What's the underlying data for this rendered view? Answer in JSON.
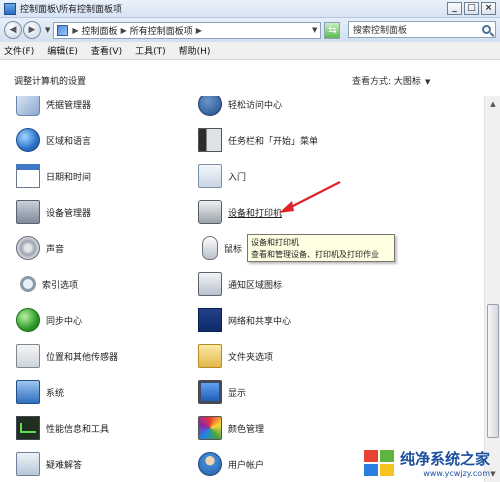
{
  "window": {
    "title": "控制面板\\所有控制面板项",
    "buttons": [
      "_",
      "□",
      "×"
    ]
  },
  "address": {
    "crumbs": [
      "控制面板",
      "所有控制面板项"
    ],
    "search_placeholder": "搜索控制面板"
  },
  "menu": [
    "文件(F)",
    "编辑(E)",
    "查看(V)",
    "工具(T)",
    "帮助(H)"
  ],
  "content": {
    "heading": "调整计算机的设置",
    "view_by_label": "查看方式:",
    "view_by_value": "大图标"
  },
  "left_items": [
    {
      "label": "凭据管理器",
      "icon": "credential-manager-icon"
    },
    {
      "label": "区域和语言",
      "icon": "globe-icon"
    },
    {
      "label": "日期和时间",
      "icon": "calendar-icon"
    },
    {
      "label": "设备管理器",
      "icon": "device-manager-icon"
    },
    {
      "label": "声音",
      "icon": "speaker-icon"
    },
    {
      "label": "索引选项",
      "icon": "indexing-icon"
    },
    {
      "label": "同步中心",
      "icon": "sync-center-icon"
    },
    {
      "label": "位置和其他传感器",
      "icon": "location-sensor-icon"
    },
    {
      "label": "系统",
      "icon": "system-icon"
    },
    {
      "label": "性能信息和工具",
      "icon": "performance-icon"
    },
    {
      "label": "疑难解答",
      "icon": "troubleshooting-icon"
    }
  ],
  "right_items": [
    {
      "label": "轻松访问中心",
      "icon": "ease-of-access-icon"
    },
    {
      "label": "任务栏和「开始」菜单",
      "icon": "taskbar-icon"
    },
    {
      "label": "入门",
      "icon": "getting-started-icon"
    },
    {
      "label": "设备和打印机",
      "icon": "printer-icon"
    },
    {
      "label": "鼠标",
      "icon": "mouse-icon"
    },
    {
      "label": "通知区域图标",
      "icon": "notification-icon"
    },
    {
      "label": "网络和共享中心",
      "icon": "network-icon"
    },
    {
      "label": "文件夹选项",
      "icon": "folder-options-icon"
    },
    {
      "label": "显示",
      "icon": "display-icon"
    },
    {
      "label": "颜色管理",
      "icon": "color-management-icon"
    },
    {
      "label": "用户帐户",
      "icon": "user-accounts-icon"
    }
  ],
  "tooltip": {
    "title": "设备和打印机",
    "description": "查看和管理设备、打印机及打印作业"
  },
  "watermark": {
    "name": "纯净系统之家",
    "url": "www.ycwjzy.com"
  },
  "colors": {
    "arrow": "#e0232b",
    "tooltip_bg": "#ffffe1",
    "watermark": "#1c4e9e"
  }
}
